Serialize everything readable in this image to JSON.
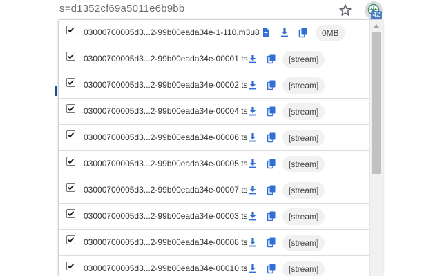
{
  "browser": {
    "url_text": "s=d1352cf69a5011e6b9bb",
    "extension_badge": "42",
    "icons": {
      "bookmark": "star-icon",
      "extension": "extension-icon"
    }
  },
  "colors": {
    "accent": "#2f6fd6",
    "badge": "#4a7ec2",
    "pill_bg": "#f1f1f1"
  },
  "popup": {
    "items": [
      {
        "filename": "03000700005d3...2-99b00eada34e-1-110.m3u8",
        "checked": true,
        "size": "0MB"
      },
      {
        "filename": "03000700005d3...2-99b00eada34e-00001.ts",
        "checked": true,
        "size": "[stream]"
      },
      {
        "filename": "03000700005d3...2-99b00eada34e-00002.ts",
        "checked": true,
        "size": "[stream]"
      },
      {
        "filename": "03000700005d3...2-99b00eada34e-00004.ts",
        "checked": true,
        "size": "[stream]"
      },
      {
        "filename": "03000700005d3...2-99b00eada34e-00006.ts",
        "checked": true,
        "size": "[stream]"
      },
      {
        "filename": "03000700005d3...2-99b00eada34e-00005.ts",
        "checked": true,
        "size": "[stream]"
      },
      {
        "filename": "03000700005d3...2-99b00eada34e-00007.ts",
        "checked": true,
        "size": "[stream]"
      },
      {
        "filename": "03000700005d3...2-99b00eada34e-00003.ts",
        "checked": true,
        "size": "[stream]"
      },
      {
        "filename": "03000700005d3...2-99b00eada34e-00008.ts",
        "checked": true,
        "size": "[stream]"
      },
      {
        "filename": "03000700005d3...2-99b00eada34e-00010.ts",
        "checked": true,
        "size": "[stream]"
      }
    ]
  }
}
